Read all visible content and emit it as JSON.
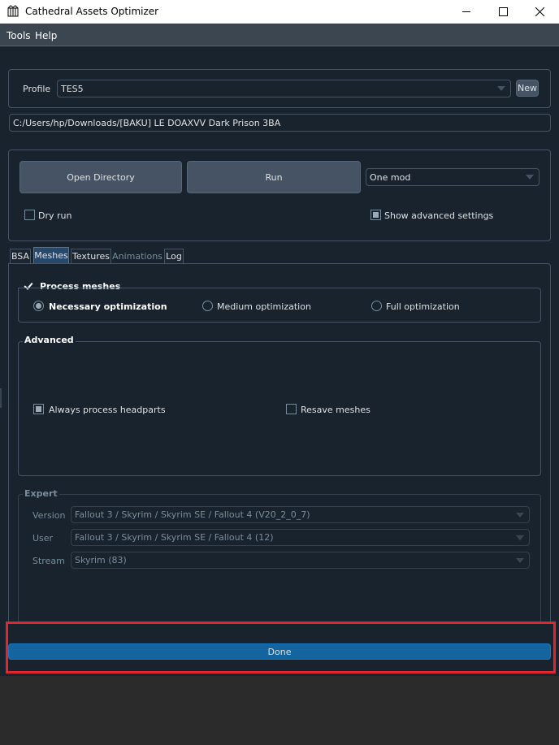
{
  "window": {
    "title": "Cathedral Assets Optimizer",
    "icon": "cathedral-icon"
  },
  "menu": {
    "items": [
      "Tools",
      "Help"
    ]
  },
  "profile": {
    "label": "Profile",
    "value": "TES5",
    "new_button": "New"
  },
  "path": {
    "value": "C:/Users/hp/Downloads/[BAKU] LE DOAXVV Dark Prison 3BA"
  },
  "actions": {
    "open_directory": "Open Directory",
    "run": "Run",
    "mode": "One mod",
    "dry_run": "Dry run",
    "dry_run_checked": false,
    "show_advanced": "Show advanced settings",
    "show_advanced_checked": true
  },
  "tabs": [
    {
      "label": "BSA",
      "active": false,
      "enabled": true
    },
    {
      "label": "Meshes",
      "active": true,
      "enabled": true
    },
    {
      "label": "Textures",
      "active": false,
      "enabled": true
    },
    {
      "label": "Animations",
      "active": false,
      "enabled": false
    },
    {
      "label": "Log",
      "active": false,
      "enabled": true
    }
  ],
  "meshes": {
    "process_label": "Process meshes",
    "process_checked": true,
    "optimization_options": [
      {
        "label": "Necessary optimization",
        "selected": true
      },
      {
        "label": "Medium optimization",
        "selected": false
      },
      {
        "label": "Full optimization",
        "selected": false
      }
    ],
    "advanced": {
      "title": "Advanced",
      "headparts_label": "Always process headparts",
      "headparts_checked": true,
      "resave_label": "Resave meshes",
      "resave_checked": false
    },
    "expert": {
      "title": "Expert",
      "version_label": "Version",
      "version_value": "Fallout 3 / Skyrim / Skyrim SE / Fallout 4 (V20_2_0_7)",
      "user_label": "User",
      "user_value": "Fallout 3 / Skyrim / Skyrim SE / Fallout 4 (12)",
      "stream_label": "Stream",
      "stream_value": "Skyrim (83)"
    }
  },
  "done_button": "Done",
  "colors": {
    "background": "#19232d",
    "accent": "#1464a0",
    "highlight": "#e2262d"
  }
}
